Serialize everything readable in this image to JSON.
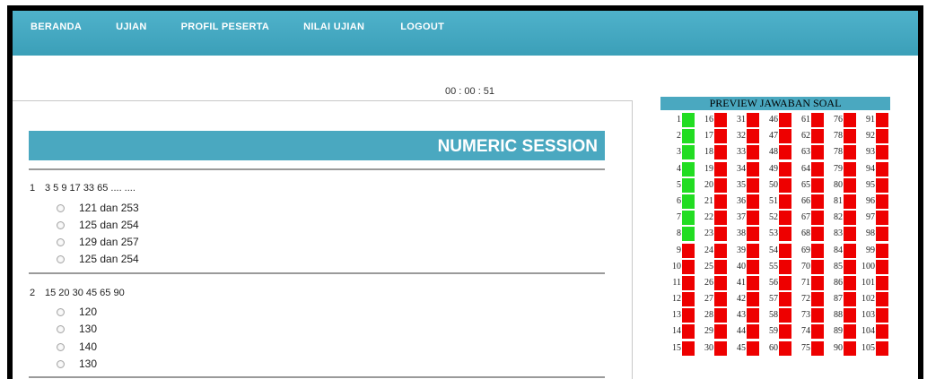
{
  "nav": {
    "items": [
      "BERANDA",
      "UJIAN",
      "PROFIL PESERTA",
      "NILAI UJIAN",
      "LOGOUT"
    ]
  },
  "timer": "00 : 00 : 51",
  "session": {
    "title": "NUMERIC SESSION"
  },
  "questions": [
    {
      "number": "1",
      "text": "3 5 9 17 33 65 .... ....",
      "options": [
        "121 dan 253",
        "125 dan 254",
        "129 dan 257",
        "125 dan 254"
      ]
    },
    {
      "number": "2",
      "text": "15 20 30 45 65 90",
      "options": [
        "120",
        "130",
        "140",
        "130"
      ]
    }
  ],
  "preview": {
    "title": "PREVIEW JAWABAN SOAL",
    "answered_color": "#22dd22",
    "unanswered_color": "#ee0000",
    "columns": [
      {
        "numbers": [
          "1",
          "2",
          "3",
          "4",
          "5",
          "6",
          "7",
          "8",
          "9",
          "10",
          "11",
          "12",
          "13",
          "14",
          "15"
        ],
        "answered": [
          true,
          true,
          true,
          true,
          true,
          true,
          true,
          true,
          false,
          false,
          false,
          false,
          false,
          false,
          false
        ]
      },
      {
        "numbers": [
          "16",
          "17",
          "18",
          "19",
          "20",
          "21",
          "22",
          "23",
          "24",
          "25",
          "26",
          "27",
          "28",
          "29",
          "30"
        ],
        "answered": [
          false,
          false,
          false,
          false,
          false,
          false,
          false,
          false,
          false,
          false,
          false,
          false,
          false,
          false,
          false
        ]
      },
      {
        "numbers": [
          "31",
          "32",
          "33",
          "34",
          "35",
          "36",
          "37",
          "38",
          "39",
          "40",
          "41",
          "42",
          "43",
          "44",
          "45"
        ],
        "answered": [
          false,
          false,
          false,
          false,
          false,
          false,
          false,
          false,
          false,
          false,
          false,
          false,
          false,
          false,
          false
        ]
      },
      {
        "numbers": [
          "46",
          "47",
          "48",
          "49",
          "50",
          "51",
          "52",
          "53",
          "54",
          "55",
          "56",
          "57",
          "58",
          "59",
          "60"
        ],
        "answered": [
          false,
          false,
          false,
          false,
          false,
          false,
          false,
          false,
          false,
          false,
          false,
          false,
          false,
          false,
          false
        ]
      },
      {
        "numbers": [
          "61",
          "62",
          "63",
          "64",
          "65",
          "66",
          "67",
          "68",
          "69",
          "70",
          "71",
          "72",
          "73",
          "74",
          "75"
        ],
        "answered": [
          false,
          false,
          false,
          false,
          false,
          false,
          false,
          false,
          false,
          false,
          false,
          false,
          false,
          false,
          false
        ]
      },
      {
        "numbers": [
          "76",
          "78",
          "78",
          "79",
          "80",
          "81",
          "82",
          "83",
          "84",
          "85",
          "86",
          "87",
          "88",
          "89",
          "90"
        ],
        "answered": [
          false,
          false,
          false,
          false,
          false,
          false,
          false,
          false,
          false,
          false,
          false,
          false,
          false,
          false,
          false
        ]
      },
      {
        "numbers": [
          "91",
          "92",
          "93",
          "94",
          "95",
          "96",
          "97",
          "98",
          "99",
          "100",
          "101",
          "102",
          "103",
          "104",
          "105"
        ],
        "answered": [
          false,
          false,
          false,
          false,
          false,
          false,
          false,
          false,
          false,
          false,
          false,
          false,
          false,
          false,
          false
        ]
      }
    ]
  }
}
